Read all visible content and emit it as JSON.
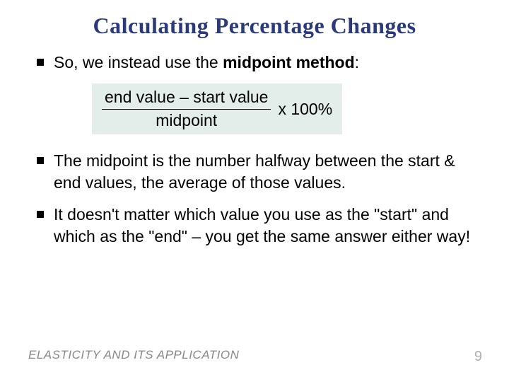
{
  "title": "Calculating Percentage Changes",
  "bullets": {
    "b1_pre": "So, we instead use the ",
    "b1_bold": "midpoint method",
    "b1_post": ":",
    "b2": "The midpoint is the number halfway between the start & end values, the average of those values.",
    "b3": "It doesn't matter which value you use as the \"start\" and which as the \"end\" – you get the same answer either way!"
  },
  "formula": {
    "numerator": "end value – start value",
    "denominator": "midpoint",
    "suffix": "x 100%"
  },
  "footer": "ELASTICITY AND ITS APPLICATION",
  "page": "9"
}
